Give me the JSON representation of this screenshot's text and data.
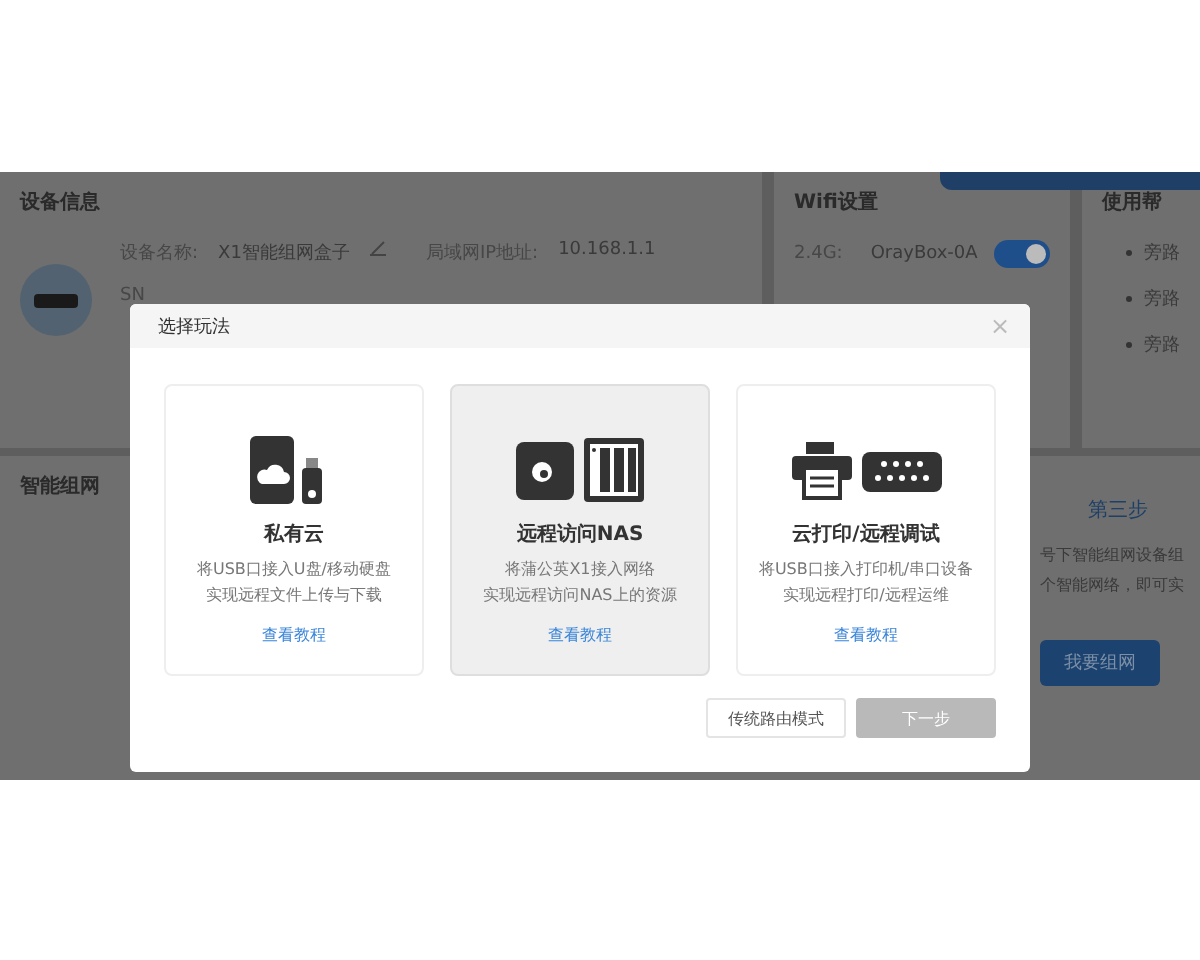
{
  "background": {
    "device_info": {
      "title": "设备信息",
      "name_label": "设备名称:",
      "name": "X1智能组网盒子",
      "ip_label": "局域网IP地址:",
      "ip": "10.168.1.1",
      "sn_label": "SN"
    },
    "wifi": {
      "title": "Wifi设置",
      "band": "2.4G:",
      "ssid": "OrayBox-0A",
      "on": true
    },
    "help": {
      "title": "使用帮",
      "items": [
        "旁路",
        "旁路",
        "旁路"
      ]
    },
    "smart_network": {
      "title": "智能组网",
      "step": "第三步",
      "lines": [
        "号下智能组网设备组",
        "个智能网络，即可实"
      ],
      "button": "我要组网"
    }
  },
  "dialog": {
    "title": "选择玩法",
    "close": "×",
    "cards": [
      {
        "kind": "cloud",
        "title": "私有云",
        "lines": [
          "将USB口接入U盘/移动硬盘",
          "实现远程文件上传与下载"
        ],
        "link": "查看教程",
        "selected": false
      },
      {
        "kind": "nas",
        "title": "远程访问NAS",
        "lines": [
          "将蒲公英X1接入网络",
          "实现远程访问NAS上的资源"
        ],
        "link": "查看教程",
        "selected": true
      },
      {
        "kind": "print",
        "title": "云打印/远程调试",
        "lines": [
          "将USB口接入打印机/串口设备",
          "实现远程打印/远程运维"
        ],
        "link": "查看教程",
        "selected": false
      }
    ],
    "buttons": [
      {
        "label": "传统路由模式",
        "disabled": false
      },
      {
        "label": "下一步",
        "disabled": true
      }
    ]
  }
}
